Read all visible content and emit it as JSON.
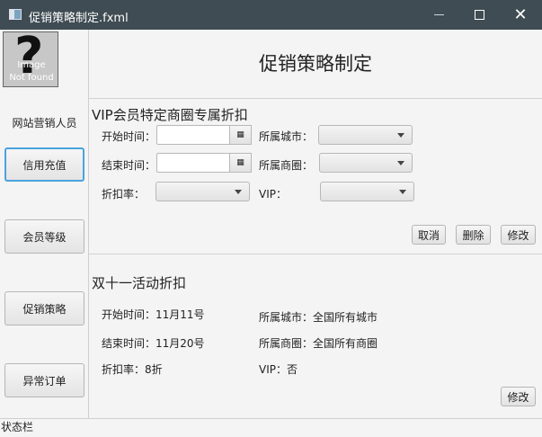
{
  "window": {
    "title": "促销策略制定.fxml",
    "minimize_icon": "minimize-icon",
    "maximize_icon": "maximize-icon",
    "close_icon": "close-icon",
    "close_glyph": "✕"
  },
  "sidebar": {
    "avatar": {
      "glyph": "?",
      "line1": "Image",
      "line2": "Not found"
    },
    "role": "网站营销人员",
    "buttons": [
      {
        "label": "信用充值",
        "active": true
      },
      {
        "label": "会员等级",
        "active": false
      },
      {
        "label": "促销策略",
        "active": false
      },
      {
        "label": "异常订单",
        "active": false
      }
    ]
  },
  "main": {
    "title": "促销策略制定",
    "vip": {
      "heading": "VIP会员特定商圈专属折扣",
      "start_label": "开始时间：",
      "start_value": "",
      "end_label": "结束时间：",
      "end_value": "",
      "rate_label": "折扣率：",
      "city_label": "所属城市：",
      "district_label": "所属商圈：",
      "vip_label": "VIP：",
      "calendar_icon": "calendar-icon",
      "calendar_glyph": "▦",
      "cancel": "取消",
      "delete": "删除",
      "modify": "修改"
    },
    "double11": {
      "heading": "双十一活动折扣",
      "start": "开始时间：11月11号",
      "end": "结束时间：11月20号",
      "rate": "折扣率：8折",
      "city": "所属城市：全国所有城市",
      "district": "所属商圈：全国所有商圈",
      "vip": "VIP：否",
      "modify": "修改"
    }
  },
  "status": "状态栏"
}
